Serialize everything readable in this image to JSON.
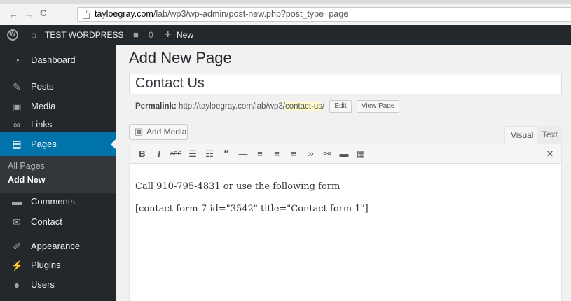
{
  "browser": {
    "back_glyph": "←",
    "forward_glyph": "→",
    "reload_glyph": "C",
    "url_domain": "tayloegray.com",
    "url_path": "/lab/wp3/wp-admin/post-new.php?post_type=page"
  },
  "adminbar": {
    "site_name": "TEST WORDPRESS",
    "comments_count": "0",
    "new_label": "New"
  },
  "sidebar": {
    "items": [
      {
        "label": "Dashboard",
        "icon": "dashboard-icon"
      },
      {
        "label": "Posts",
        "icon": "pin-icon"
      },
      {
        "label": "Media",
        "icon": "media-icon"
      },
      {
        "label": "Links",
        "icon": "link-icon"
      },
      {
        "label": "Pages",
        "icon": "pages-icon"
      },
      {
        "label": "Comments",
        "icon": "comment-icon"
      },
      {
        "label": "Contact",
        "icon": "mail-icon"
      },
      {
        "label": "Appearance",
        "icon": "brush-icon"
      },
      {
        "label": "Plugins",
        "icon": "plugin-icon"
      },
      {
        "label": "Users",
        "icon": "users-icon"
      }
    ],
    "submenu": [
      "All Pages",
      "Add New"
    ],
    "active": "Pages",
    "accent_color": "#0073aa"
  },
  "main": {
    "page_title": "Add New Page",
    "post_title": "Contact Us",
    "permalink_label": "Permalink:",
    "permalink_base": "http://tayloegray.com/lab/wp3/",
    "permalink_slug": "contact-us",
    "permalink_trailing": "/",
    "edit_button": "Edit",
    "view_page_button": "View Page",
    "add_media_button": "Add Media",
    "tab_visual": "Visual",
    "tab_text": "Text",
    "toolbar": [
      "bold",
      "italic",
      "strikethrough",
      "bullet-list",
      "numbered-list",
      "blockquote",
      "horizontal-rule",
      "align-left",
      "align-center",
      "align-right",
      "insert-link",
      "remove-link",
      "read-more",
      "toolbar-toggle",
      "fullscreen"
    ],
    "content_line1": "Call 910-795-4831 or use the following form",
    "content_line2": "[contact-form-7 id=\"3542\" title=\"Contact form 1\"]"
  }
}
